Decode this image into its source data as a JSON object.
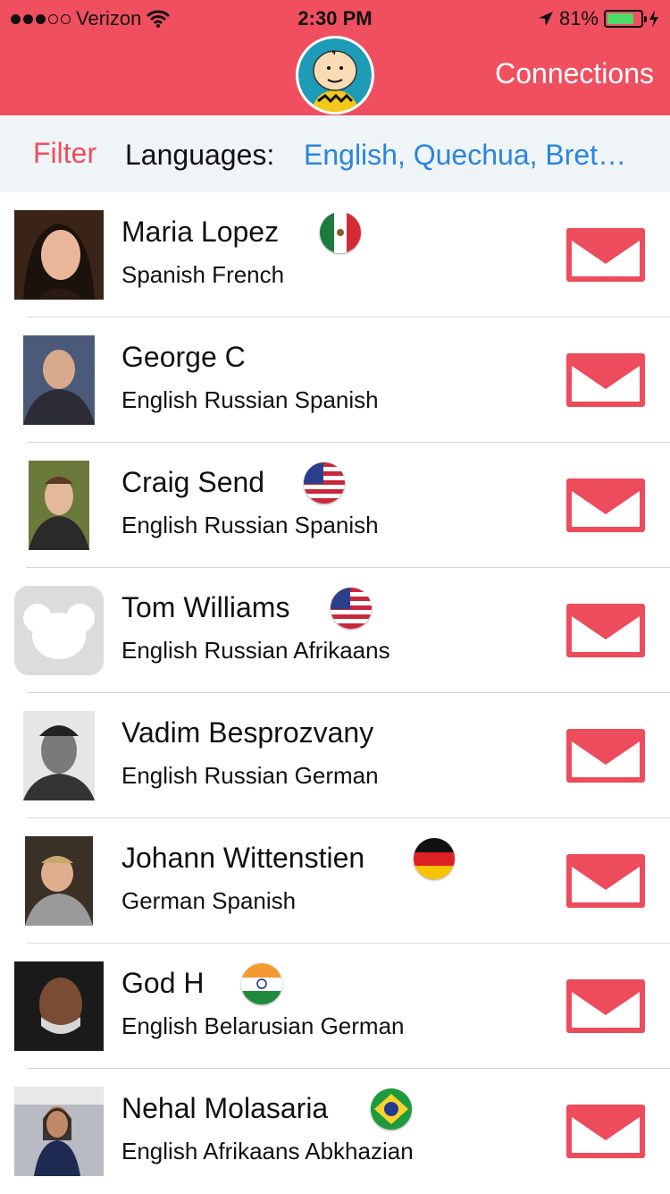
{
  "status": {
    "carrier": "Verizon",
    "time": "2:30 PM",
    "battery": "81%"
  },
  "header": {
    "title": "Connections"
  },
  "filter": {
    "label": "Filter",
    "languages_label": "Languages:",
    "languages_value": "English, Quechua, Bret…"
  },
  "colors": {
    "accent": "#f04f5f",
    "link": "#2a86dd",
    "mail": "#ec4c5c"
  },
  "contacts": [
    {
      "name": "Maria Lopez",
      "languages": "Spanish French",
      "flag": "mexico"
    },
    {
      "name": "George C",
      "languages": "English Russian Spanish",
      "flag": ""
    },
    {
      "name": "Craig Send",
      "languages": "English Russian Spanish",
      "flag": "usa"
    },
    {
      "name": "Tom Williams",
      "languages": "English Russian Afrikaans",
      "flag": "usa"
    },
    {
      "name": "Vadim Besprozvany",
      "languages": "English Russian German",
      "flag": ""
    },
    {
      "name": "Johann Wittenstien",
      "languages": "German Spanish",
      "flag": "germany"
    },
    {
      "name": "God H",
      "languages": "English Belarusian German",
      "flag": "india"
    },
    {
      "name": "Nehal Molasaria",
      "languages": "English Afrikaans Abkhazian",
      "flag": "brazil"
    }
  ]
}
